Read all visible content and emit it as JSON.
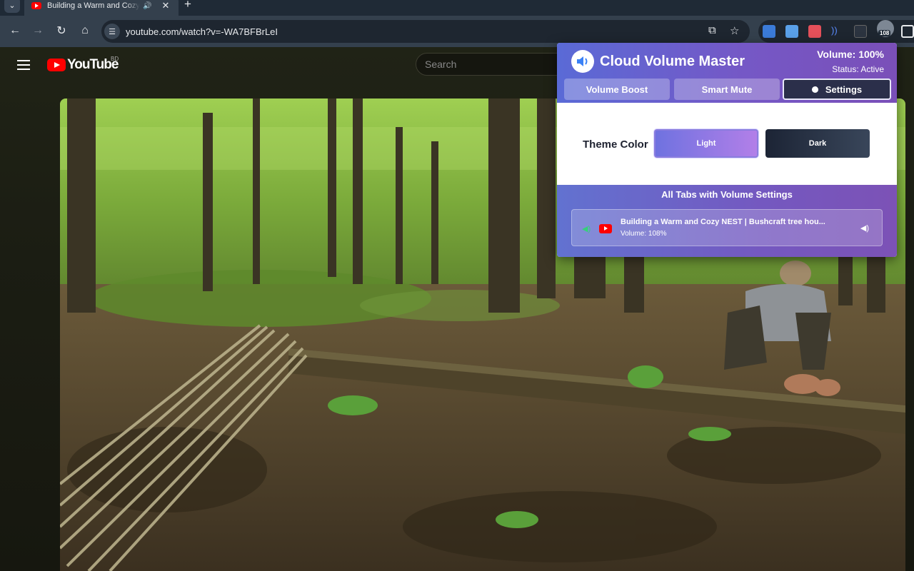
{
  "browser": {
    "tab": {
      "title": "Building a Warm and Cozy NEST | Bushcraft tree house",
      "audio_icon": "🔊",
      "close": "✕"
    },
    "new_tab": "+",
    "tab_menu": "⌄",
    "nav": {
      "back": "←",
      "forward": "→",
      "reload": "↻",
      "home": "⌂"
    },
    "url": "youtube.com/watch?v=-WA7BFBrLeI",
    "extension_badge": "108"
  },
  "youtube": {
    "logo_text": "YouTube",
    "country_code": "BD",
    "search_placeholder": "Search"
  },
  "popup": {
    "title": "Cloud Volume Master",
    "volume_text": "Volume: 100%",
    "status_text": "Status: Active",
    "tabs": [
      {
        "label": "Volume Boost",
        "active": false
      },
      {
        "label": "Smart Mute",
        "active": false
      },
      {
        "label": "Settings",
        "active": true
      }
    ],
    "settings": {
      "theme_label": "Theme Color",
      "theme_options": [
        "Light",
        "Dark"
      ],
      "selected_theme": "Light"
    },
    "tab_list": {
      "title": "All Tabs with Volume Settings",
      "items": [
        {
          "title": "Building a Warm and Cozy NEST | Bushcraft tree hou...",
          "volume": "Volume: 108%"
        }
      ]
    },
    "colors": {
      "header_start": "#5a6ad6",
      "header_end": "#7a4fb8",
      "active_tab": "#2b2f4a",
      "dark_theme": "#1c2435"
    }
  }
}
